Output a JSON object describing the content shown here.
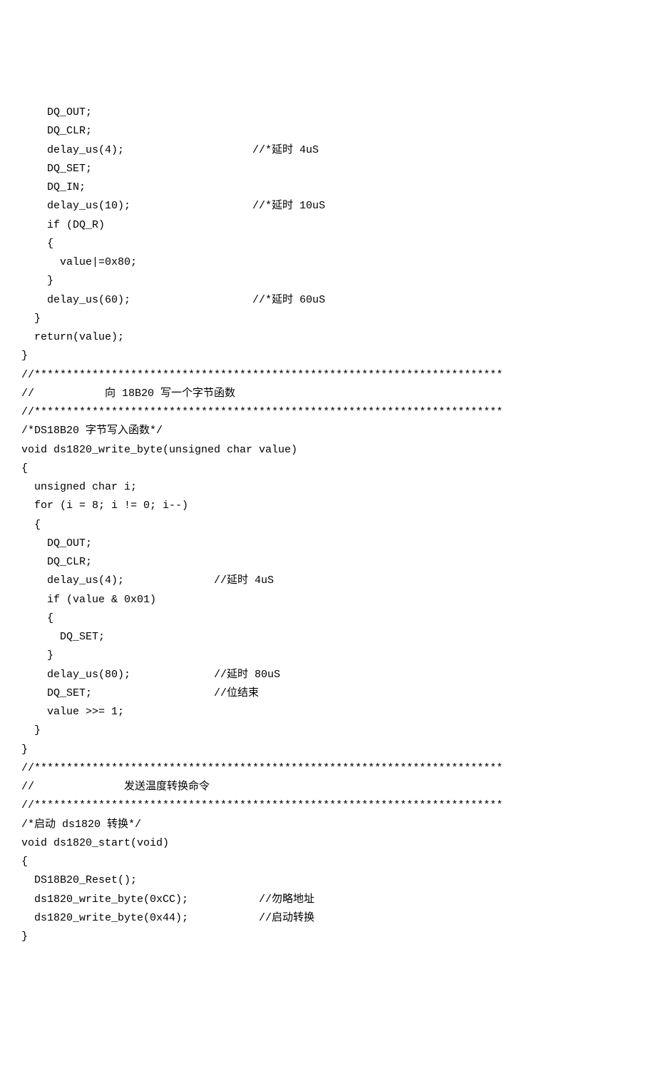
{
  "code_lines": [
    "    DQ_OUT;",
    "    DQ_CLR;",
    "    delay_us(4);                    //*延时 4uS",
    "    DQ_SET;",
    "    DQ_IN;",
    "    delay_us(10);                   //*延时 10uS",
    "    if (DQ_R)",
    "    {",
    "      value|=0x80;",
    "    }",
    "    delay_us(60);                   //*延时 60uS",
    "  }",
    "  return(value);",
    "}",
    "",
    "//*************************************************************************",
    "//           向 18B20 写一个字节函数",
    "//*************************************************************************",
    "",
    "/*DS18B20 字节写入函数*/",
    "void ds1820_write_byte(unsigned char value)",
    "{",
    "  unsigned char i;",
    "  for (i = 8; i != 0; i--)",
    "  {",
    "    DQ_OUT;",
    "    DQ_CLR;",
    "    delay_us(4);              //延时 4uS",
    "    if (value & 0x01)",
    "    {",
    "      DQ_SET;",
    "    }",
    "    delay_us(80);             //延时 80uS",
    "    DQ_SET;                   //位结束",
    "    value >>= 1;",
    "  }",
    "}",
    "//*************************************************************************",
    "//              发送温度转换命令",
    "//*************************************************************************",
    "",
    "/*启动 ds1820 转换*/",
    "void ds1820_start(void)",
    "{",
    "  DS18B20_Reset();",
    "  ds1820_write_byte(0xCC);           //勿略地址",
    "  ds1820_write_byte(0x44);           //启动转换",
    "}"
  ]
}
